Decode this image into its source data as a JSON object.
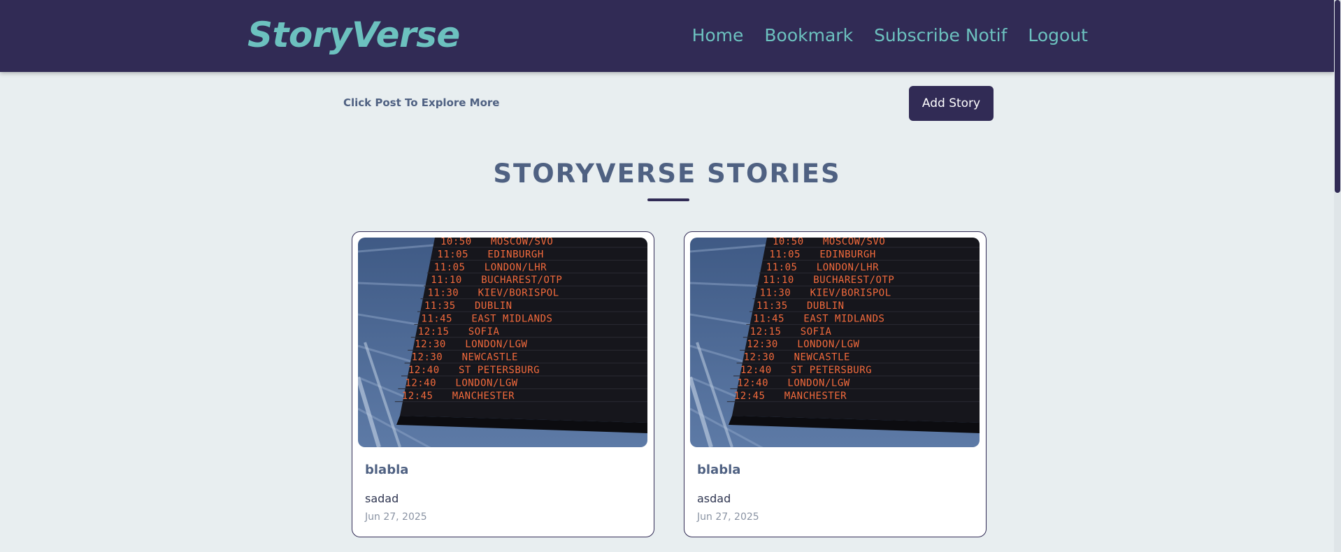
{
  "navbar": {
    "logo": "StoryVerse",
    "links": [
      {
        "label": "Home"
      },
      {
        "label": "Bookmark"
      },
      {
        "label": "Subscribe Notif"
      },
      {
        "label": "Logout"
      }
    ]
  },
  "toolbar": {
    "hint": "Click Post To Explore More",
    "add_story_label": "Add Story"
  },
  "section": {
    "title": "STORYVERSE STORIES"
  },
  "stories": [
    {
      "title": "blabla",
      "description": "sadad",
      "date": "Jun 27, 2025"
    },
    {
      "title": "blabla",
      "description": "asdad",
      "date": "Jun 27, 2025"
    }
  ],
  "board": {
    "rows": [
      {
        "time": "10:50",
        "dest": "MOSCOW/SVO"
      },
      {
        "time": "11:05",
        "dest": "EDINBURGH"
      },
      {
        "time": "11:05",
        "dest": "LONDON/LHR"
      },
      {
        "time": "11:10",
        "dest": "BUCHAREST/OTP"
      },
      {
        "time": "11:30",
        "dest": "KIEV/BORISPOL"
      },
      {
        "time": "11:35",
        "dest": "DUBLIN"
      },
      {
        "time": "11:45",
        "dest": "EAST MIDLANDS"
      },
      {
        "time": "12:15",
        "dest": "SOFIA"
      },
      {
        "time": "12:30",
        "dest": "LONDON/LGW"
      },
      {
        "time": "12:30",
        "dest": "NEWCASTLE"
      },
      {
        "time": "12:40",
        "dest": "ST PETERSBURG"
      },
      {
        "time": "12:40",
        "dest": "LONDON/LGW"
      },
      {
        "time": "12:45",
        "dest": "MANCHESTER"
      }
    ]
  },
  "colors": {
    "navbar_bg": "#312b55",
    "accent": "#6cc1bf",
    "page_bg": "#e8eef0",
    "board_text": "#f26a3c"
  }
}
